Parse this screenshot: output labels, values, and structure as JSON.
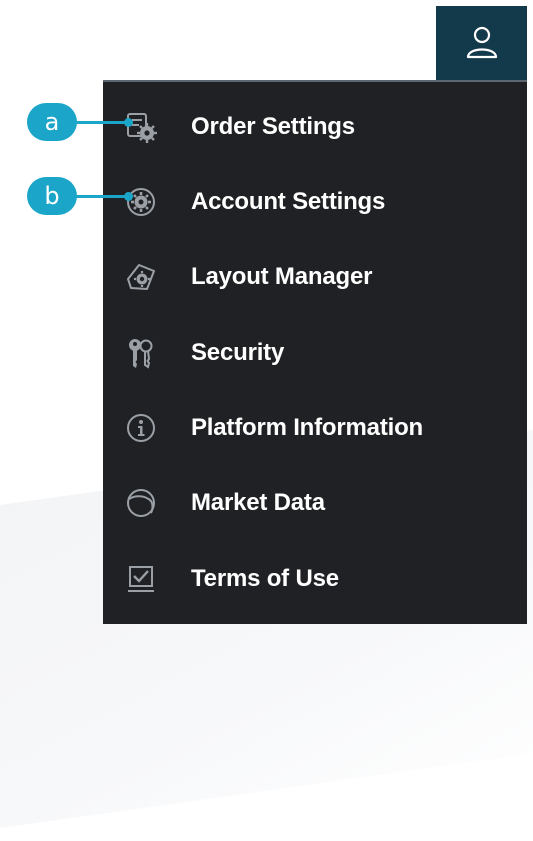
{
  "header": {
    "user_icon": "user-icon"
  },
  "menu": {
    "items": [
      {
        "label": "Order Settings",
        "icon": "order-settings-icon"
      },
      {
        "label": "Account Settings",
        "icon": "account-settings-icon"
      },
      {
        "label": "Layout Manager",
        "icon": "layout-manager-icon"
      },
      {
        "label": "Security",
        "icon": "keys-icon"
      },
      {
        "label": "Platform Information",
        "icon": "info-icon"
      },
      {
        "label": "Market Data",
        "icon": "globe-icon"
      },
      {
        "label": "Terms of Use",
        "icon": "checkbox-icon"
      }
    ]
  },
  "callouts": {
    "a": "a",
    "b": "b"
  },
  "colors": {
    "header_bg": "#133a4b",
    "menu_bg": "#202124",
    "callout": "#1ba6c9",
    "icon_gray": "#9aa0a6"
  }
}
